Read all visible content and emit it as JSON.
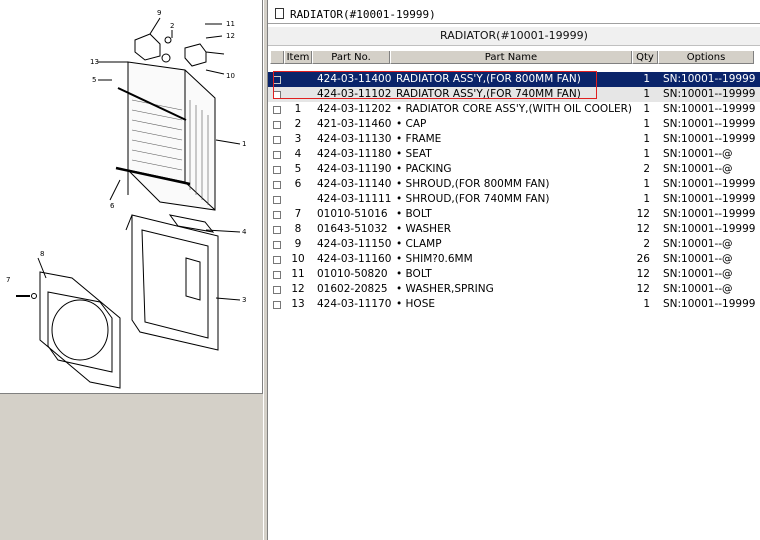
{
  "window": {
    "title": "RADIATOR(#10001-19999)"
  },
  "table": {
    "caption": "RADIATOR(#10001-19999)",
    "headers": {
      "item": "Item",
      "part_no": "Part No.",
      "part_name": "Part Name",
      "qty": "Qty",
      "options": "Options"
    },
    "rows": [
      {
        "item": "",
        "part_no": "424-03-11400",
        "name": "RADIATOR ASS'Y,(FOR 800MM FAN)",
        "qty": "1",
        "options": "SN:10001--19999"
      },
      {
        "item": "",
        "part_no": "424-03-11102",
        "name": "RADIATOR ASS'Y,(FOR 740MM FAN)",
        "qty": "1",
        "options": "SN:10001--19999"
      },
      {
        "item": "1",
        "part_no": "424-03-11202",
        "name": "•  RADIATOR CORE ASS'Y,(WITH OIL COOLER)",
        "qty": "1",
        "options": "SN:10001--19999"
      },
      {
        "item": "2",
        "part_no": "421-03-11460",
        "name": "•  CAP",
        "qty": "1",
        "options": "SN:10001--19999"
      },
      {
        "item": "3",
        "part_no": "424-03-11130",
        "name": "•  FRAME",
        "qty": "1",
        "options": "SN:10001--19999"
      },
      {
        "item": "4",
        "part_no": "424-03-11180",
        "name": "•  SEAT",
        "qty": "1",
        "options": "SN:10001--@"
      },
      {
        "item": "5",
        "part_no": "424-03-11190",
        "name": "•  PACKING",
        "qty": "2",
        "options": "SN:10001--@"
      },
      {
        "item": "6",
        "part_no": "424-03-11140",
        "name": "•  SHROUD,(FOR 800MM FAN)",
        "qty": "1",
        "options": "SN:10001--19999"
      },
      {
        "item": "",
        "part_no": "424-03-11111",
        "name": "•  SHROUD,(FOR 740MM FAN)",
        "qty": "1",
        "options": "SN:10001--19999"
      },
      {
        "item": "7",
        "part_no": "01010-51016",
        "name": "•  BOLT",
        "qty": "12",
        "options": "SN:10001--19999"
      },
      {
        "item": "8",
        "part_no": "01643-51032",
        "name": "•  WASHER",
        "qty": "12",
        "options": "SN:10001--19999"
      },
      {
        "item": "9",
        "part_no": "424-03-11150",
        "name": "•  CLAMP",
        "qty": "2",
        "options": "SN:10001--@"
      },
      {
        "item": "10",
        "part_no": "424-03-11160",
        "name": "•  SHIM?0.6MM",
        "qty": "26",
        "options": "SN:10001--@"
      },
      {
        "item": "11",
        "part_no": "01010-50820",
        "name": "•  BOLT",
        "qty": "12",
        "options": "SN:10001--@"
      },
      {
        "item": "12",
        "part_no": "01602-20825",
        "name": "•  WASHER,SPRING",
        "qty": "12",
        "options": "SN:10001--@"
      },
      {
        "item": "13",
        "part_no": "424-03-11170",
        "name": "•  HOSE",
        "qty": "1",
        "options": "SN:10001--19999"
      }
    ]
  },
  "diagram": {
    "callouts": [
      "1",
      "2",
      "3",
      "4",
      "5",
      "6",
      "7",
      "8",
      "9",
      "10",
      "11",
      "12",
      "13"
    ]
  },
  "colors": {
    "selected_row": "#0a246a",
    "highlight_box": "#e02020",
    "panel_bg": "#d4d0c8"
  }
}
